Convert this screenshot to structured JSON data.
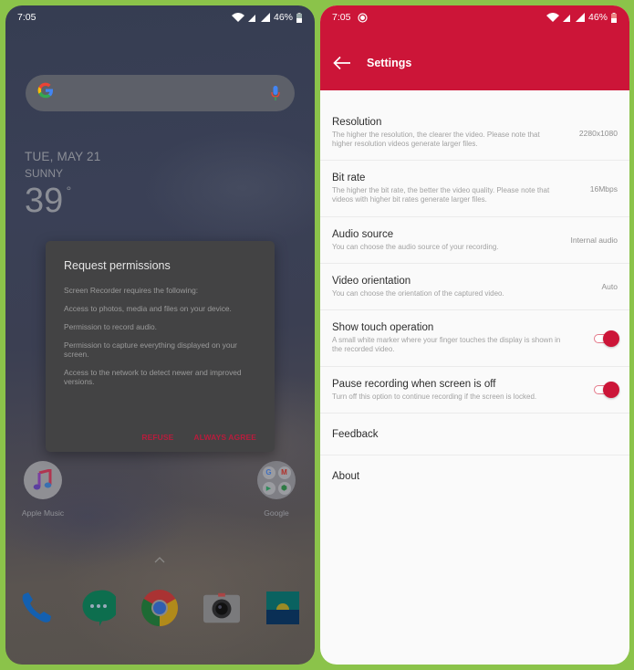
{
  "left_screen": {
    "status_bar": {
      "time": "7:05",
      "battery": "46%"
    },
    "search_bar": {
      "logo": "G",
      "mic_icon": "mic-icon"
    },
    "weather": {
      "date": "TUE, MAY 21",
      "condition": "SUNNY",
      "temperature": "39",
      "degree": "°"
    },
    "dialog": {
      "title": "Request permissions",
      "lines": [
        "Screen Recorder requires the following:",
        "Access to photos, media and files on your device.",
        "Permission to record audio.",
        "Permission to capture everything displayed on your screen.",
        "Access to the network to detect newer and improved versions."
      ],
      "refuse_label": "REFUSE",
      "agree_label": "ALWAYS AGREE"
    },
    "apps": [
      {
        "label": "Apple Music",
        "icon": "music-note-icon"
      },
      {
        "label": "Google",
        "icon": "google-folder-icon",
        "folder": [
          "G",
          "M",
          "▶",
          "⬢"
        ]
      }
    ],
    "drawer_chevron": "^",
    "dock": [
      {
        "name": "Phone",
        "icon": "phone-icon"
      },
      {
        "name": "Hangouts",
        "icon": "hangouts-icon"
      },
      {
        "name": "Chrome",
        "icon": "chrome-icon"
      },
      {
        "name": "Camera",
        "icon": "camera-icon"
      },
      {
        "name": "Gallery",
        "icon": "gallery-icon"
      }
    ]
  },
  "right_screen": {
    "status_bar": {
      "time": "7:05",
      "battery": "46%",
      "recording_icon": "record-icon"
    },
    "app_bar": {
      "title": "Settings",
      "back_icon": "arrow-back-icon"
    },
    "accent_color": "#cc1538",
    "settings": [
      {
        "title": "Resolution",
        "description": "The higher the resolution, the clearer the video. Please note that higher resolution videos generate larger files.",
        "value": "2280x1080"
      },
      {
        "title": "Bit rate",
        "description": "The higher the bit rate, the better the video quality. Please note that videos with higher bit rates generate larger files.",
        "value": "16Mbps"
      },
      {
        "title": "Audio source",
        "description": "You can choose the audio source of your recording.",
        "value": "Internal audio"
      },
      {
        "title": "Video orientation",
        "description": "You can choose the orientation of the captured video.",
        "value": "Auto"
      },
      {
        "title": "Show touch operation",
        "description": "A small white marker where your finger touches the display is shown in the recorded video.",
        "toggle": true
      },
      {
        "title": "Pause recording when screen is off",
        "description": "Turn off this option to continue recording if the screen is locked.",
        "toggle": true
      },
      {
        "title": "Feedback"
      },
      {
        "title": "About"
      }
    ]
  }
}
